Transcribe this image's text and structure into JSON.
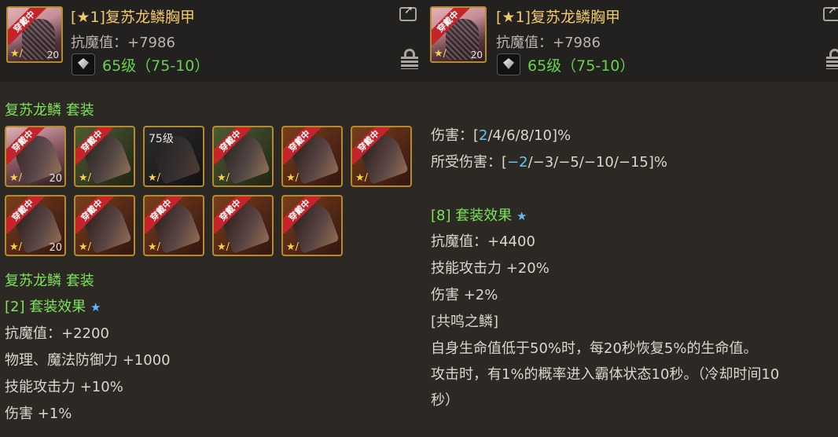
{
  "item_card": {
    "ribbon": "穿戴中",
    "stack": "20",
    "star_badge": "★/",
    "title": "[★1]复苏龙鳞胸甲",
    "stat": "抗魔值：+7986",
    "level": "65级（75-10）"
  },
  "left_panel": {
    "set_name_top": "复苏龙鳞  套装",
    "slots": [
      {
        "ribbon": "穿戴中",
        "count": "20",
        "star": "★/",
        "level": ""
      },
      {
        "ribbon": "穿戴中",
        "count": "",
        "star": "★/",
        "level": ""
      },
      {
        "ribbon": "",
        "count": "",
        "star": "★/",
        "level": "75级"
      },
      {
        "ribbon": "穿戴中",
        "count": "",
        "star": "★/",
        "level": ""
      },
      {
        "ribbon": "穿戴中",
        "count": "",
        "star": "★/",
        "level": ""
      },
      {
        "ribbon": "穿戴中",
        "count": "",
        "star": "★/",
        "level": ""
      },
      {
        "ribbon": "穿戴中",
        "count": "20",
        "star": "★/",
        "level": ""
      },
      {
        "ribbon": "穿戴中",
        "count": "",
        "star": "★/",
        "level": ""
      },
      {
        "ribbon": "穿戴中",
        "count": "",
        "star": "★/",
        "level": ""
      },
      {
        "ribbon": "穿戴中",
        "count": "",
        "star": "★/",
        "level": ""
      },
      {
        "ribbon": "穿戴中",
        "count": "",
        "star": "★/",
        "level": ""
      }
    ],
    "set_name_bottom": "复苏龙鳞  套装",
    "effect_header": "[2] 套装效果",
    "effect_lines": [
      "抗魔值：+2200",
      "物理、魔法防御力 +1000",
      "技能攻击力 +10%",
      "伤害 +1%"
    ]
  },
  "right_panel": {
    "damage_prefix": "伤害：[",
    "damage_highlight": "2",
    "damage_suffix": "/4/6/8/10]%",
    "taken_prefix": "所受伤害：[",
    "taken_highlight": "−2",
    "taken_suffix": "/−3/−5/−10/−15]%",
    "effect_header": "[8] 套装效果",
    "effect_lines": [
      "抗魔值：+4400",
      "技能攻击力 +20%",
      "伤害 +2%",
      "[共鸣之鳞]",
      "自身生命值低于50%时，每20秒恢复5%的生命值。",
      "攻击时，有1%的概率进入霸体状态10秒。（冷却时间10",
      "秒）"
    ]
  },
  "icons": {
    "star": "★",
    "share": "share-icon",
    "lock": "lock-icon",
    "gem": "diamond-gem-icon"
  },
  "colors": {
    "title_gold": "#f0c96a",
    "set_green": "#7ee35a",
    "highlight_blue": "#63c6ea",
    "ribbon_red": "#c4242a",
    "background": "#2c2823"
  }
}
